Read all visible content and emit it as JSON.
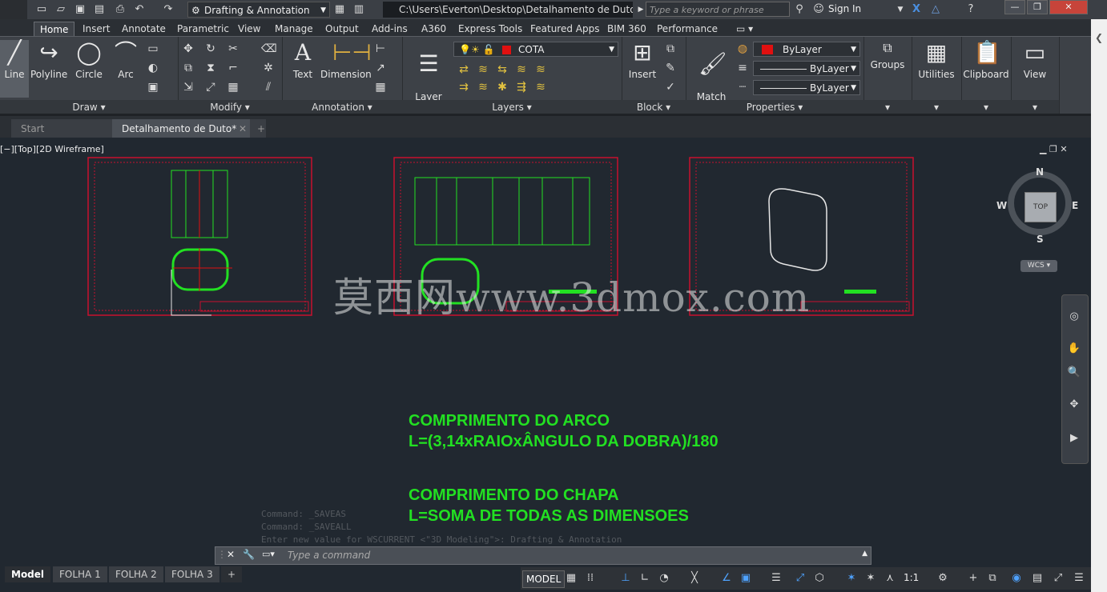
{
  "titlebar": {
    "workspace": "Drafting & Annotation",
    "file_path": "C:\\Users\\Everton\\Desktop\\Detalhamento de Duto.dwg",
    "search_placeholder": "Type a keyword or phrase",
    "sign_in": "Sign In"
  },
  "ribbon_tabs": [
    "Home",
    "Insert",
    "Annotate",
    "Parametric",
    "View",
    "Manage",
    "Output",
    "Add-ins",
    "A360",
    "Express Tools",
    "Featured Apps",
    "BIM 360",
    "Performance"
  ],
  "ribbon": {
    "draw": {
      "title": "Draw",
      "line": "Line",
      "polyline": "Polyline",
      "circle": "Circle",
      "arc": "Arc"
    },
    "modify": {
      "title": "Modify"
    },
    "annotation": {
      "title": "Annotation",
      "text": "Text",
      "dimension": "Dimension"
    },
    "layers": {
      "title": "Layers",
      "layer_properties": "Layer\nProperties",
      "current_layer": "COTA"
    },
    "block": {
      "title": "Block",
      "insert": "Insert"
    },
    "properties": {
      "title": "Properties",
      "match": "Match\nProperties",
      "color": "ByLayer",
      "linetype": "ByLayer",
      "lineweight": "ByLayer"
    },
    "groups": {
      "label": "Groups"
    },
    "utilities": {
      "label": "Utilities"
    },
    "clipboard": {
      "label": "Clipboard"
    },
    "view": {
      "label": "View"
    }
  },
  "doc_tabs": {
    "start": "Start",
    "active": "Detalhamento de Duto*"
  },
  "viewport_label": "[−][Top][2D Wireframe]",
  "viewcube": {
    "n": "N",
    "s": "S",
    "e": "E",
    "w": "W",
    "top": "TOP",
    "wcs": "WCS"
  },
  "annotations": {
    "line1": "COMPRIMENTO DO ARCO",
    "line2": "L=(3,14xRAIOxÂNGULO DA DOBRA)/180",
    "line3": "COMPRIMENTO DO CHAPA",
    "line4": "L=SOMA DE TODAS AS DIMENSOES"
  },
  "watermark": "莫西网www.3dmox.com",
  "command_history": [
    "Command: _SAVEAS",
    "Command: _SAVEALL",
    "Enter new value for WSCURRENT <\"3D Modeling\">: Drafting & Annotation"
  ],
  "command_placeholder": "Type a command",
  "layout_tabs": [
    "Model",
    "FOLHA 1",
    "FOLHA 2",
    "FOLHA 3"
  ],
  "status": {
    "model": "MODEL",
    "scale": "1:1"
  },
  "colors": {
    "accent_red": "#e01010",
    "drawing_green": "#22e022",
    "background": "#212830"
  }
}
